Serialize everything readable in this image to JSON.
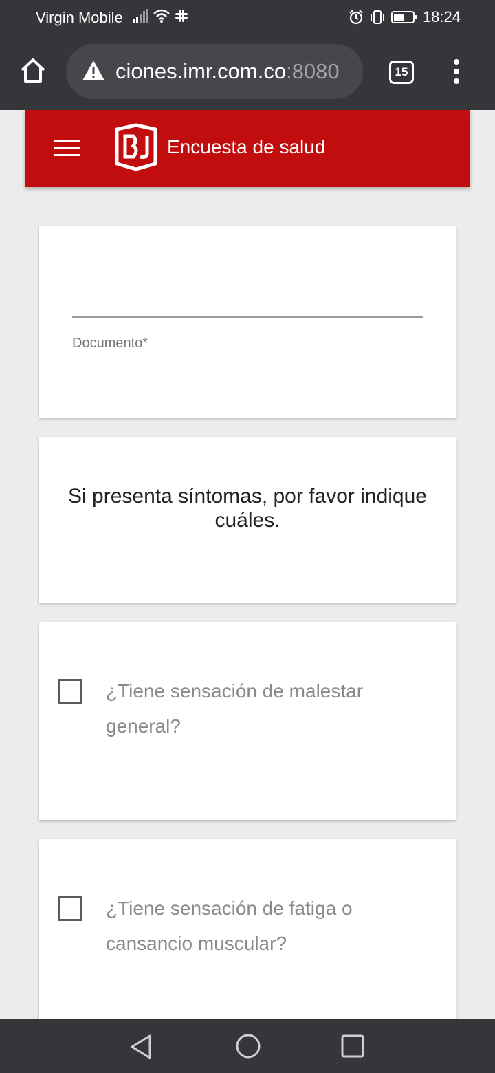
{
  "status_bar": {
    "carrier": "Virgin Mobile",
    "time": "18:24",
    "icons": [
      "signal-icon",
      "wifi-icon",
      "slack-icon",
      "alarm-icon",
      "vibrate-icon",
      "battery-icon"
    ]
  },
  "browser": {
    "url_host": "ciones.imr.com.co",
    "url_port": ":8080",
    "tab_count": "15"
  },
  "app": {
    "title": "Encuesta de salud",
    "brand_color": "#c20d0e"
  },
  "form": {
    "document_label": "Documento*",
    "document_value": "",
    "symptoms_heading": "Si presenta síntomas, por favor indique cuáles.",
    "questions": [
      {
        "label": "¿Tiene sensación de malestar general?",
        "checked": false
      },
      {
        "label": "¿Tiene sensación de fatiga o cansancio muscular?",
        "checked": false
      }
    ]
  }
}
